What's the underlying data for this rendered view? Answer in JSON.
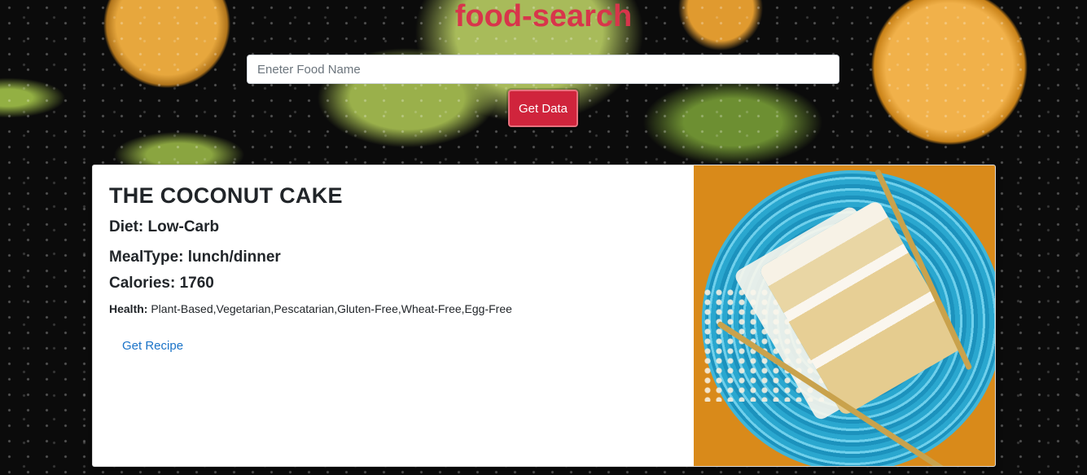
{
  "header": {
    "app_title": "food-search"
  },
  "search": {
    "placeholder": "Eneter Food Name",
    "value": "",
    "button_label": "Get Data"
  },
  "result": {
    "name": "THE COCONUT CAKE",
    "diet_label": "Diet: Low-Carb",
    "meal_type_label": "MealType: lunch/dinner",
    "calories_label": "Calories: 1760",
    "health_label": "Health:",
    "health_values": "Plant-Based,Vegetarian,Pescatarian,Gluten-Free,Wheat-Free,Egg-Free",
    "recipe_link_label": "Get Recipe"
  },
  "colors": {
    "title": "#d8354b",
    "button": "#d0243c",
    "link": "#1a73c8"
  }
}
